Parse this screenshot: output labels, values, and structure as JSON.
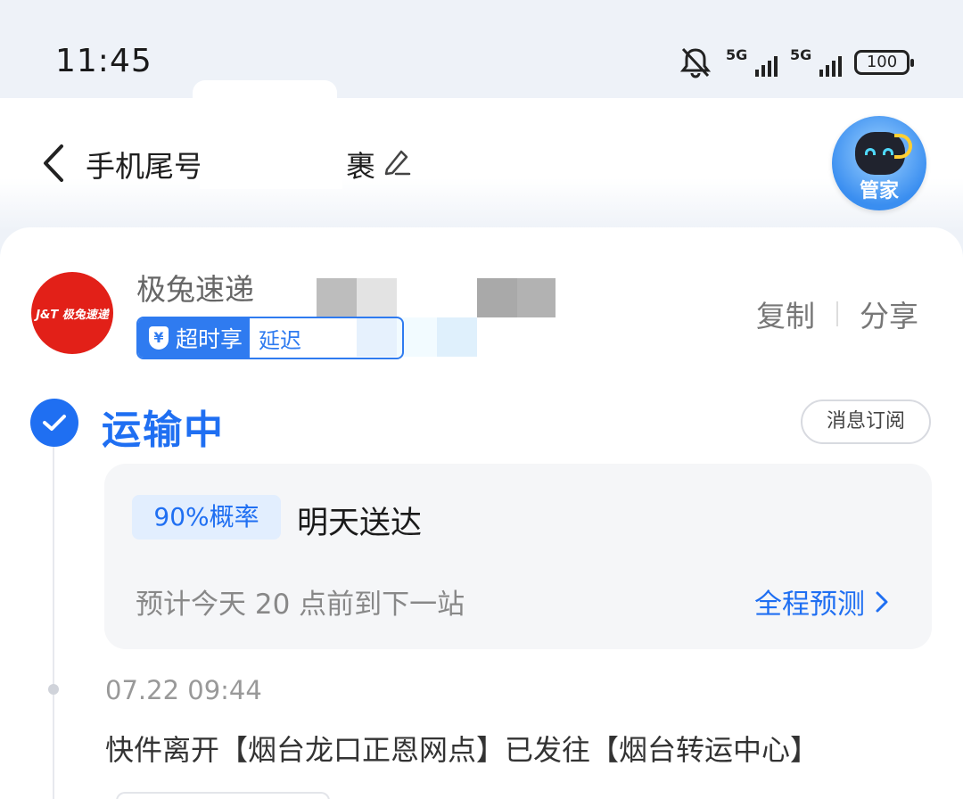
{
  "status_bar": {
    "time": "11:45",
    "network1": "5G",
    "network2": "5G",
    "battery": "100"
  },
  "header": {
    "title_prefix": "手机尾号",
    "title_suffix": "裹",
    "assistant_label": "管家"
  },
  "carrier": {
    "logo_text": "J&T 极兔速递",
    "name": "极兔速递",
    "badge_label": "超时享",
    "badge_icon": "¥",
    "badge_detail": "延迟",
    "copy_label": "复制",
    "share_label": "分享"
  },
  "status": {
    "label": "运输中",
    "subscribe_label": "消息订阅"
  },
  "prediction": {
    "probability": "90%概率",
    "arrival": "明天送达",
    "eta": "预计今天 20 点前到下一站",
    "full_link": "全程预测"
  },
  "events": [
    {
      "time": "07.22 09:44",
      "description": "快件离开【烟台龙口正恩网点】已发往【烟台转运中心】"
    }
  ],
  "colors": {
    "accent": "#1f6ff2",
    "brand_red": "#e22018",
    "page_bg": "#eef2f8"
  }
}
